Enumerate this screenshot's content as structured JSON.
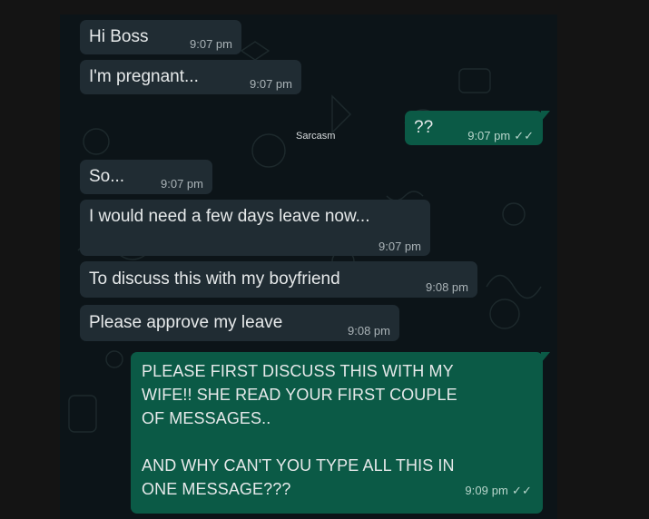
{
  "messages": [
    {
      "text": "Hi Boss",
      "time": "9:07 pm"
    },
    {
      "text": "I'm pregnant...",
      "time": "9:07 pm"
    },
    {
      "text": "??",
      "time": "9:07 pm"
    },
    {
      "text": "So...",
      "time": "9:07 pm"
    },
    {
      "text": "I would need a few days leave now...",
      "time": "9:07 pm"
    },
    {
      "text": "To discuss this with my boyfriend",
      "time": "9:08 pm"
    },
    {
      "text": "Please approve my leave",
      "time": "9:08 pm"
    },
    {
      "line1": "PLEASE FIRST DISCUSS THIS WITH MY",
      "line2": "WIFE!! SHE READ YOUR FIRST COUPLE",
      "line3": "OF MESSAGES..",
      "line4": "AND WHY CAN'T YOU TYPE ALL THIS IN",
      "line5": "ONE MESSAGE???",
      "time": "9:09 pm"
    }
  ],
  "overlay_label": "Sarcasm",
  "read_ticks": "✓✓",
  "colors": {
    "incoming_bubble": "#202c33",
    "outgoing_bubble": "#0b5a46",
    "chat_background": "#0c1418"
  }
}
